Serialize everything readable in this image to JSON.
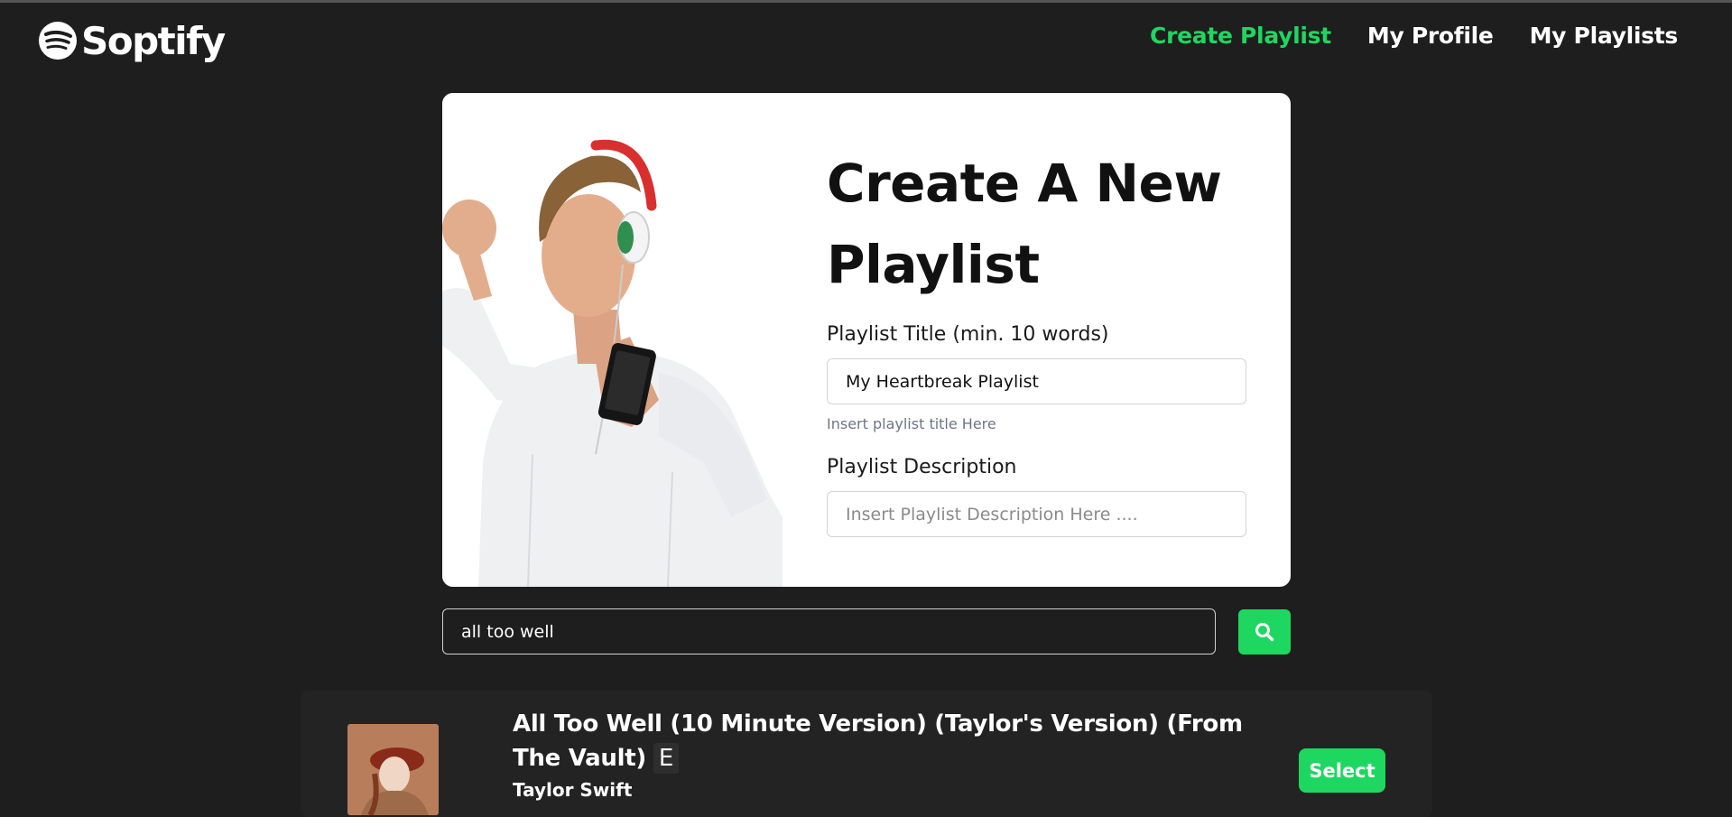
{
  "brand": {
    "name": "Soptify",
    "icon": "spotify-logo-icon"
  },
  "nav": {
    "links": [
      {
        "label": "Create Playlist",
        "active": true
      },
      {
        "label": "My Profile",
        "active": false
      },
      {
        "label": "My Playlists",
        "active": false
      }
    ]
  },
  "form": {
    "title": "Create A New Playlist",
    "title_label": "Playlist Title (min. 10 words)",
    "title_value": "My Heartbreak Playlist",
    "title_hint": "Insert playlist title Here",
    "description_label": "Playlist Description",
    "description_placeholder": "Insert Playlist Description Here ...."
  },
  "search": {
    "value": "all too well",
    "icon": "search-icon"
  },
  "results": [
    {
      "title": "All Too Well (10 Minute Version) (Taylor's Version) (From The Vault)",
      "explicit": "E",
      "artist": "Taylor Swift",
      "action": "Select"
    }
  ],
  "colors": {
    "accent": "#1ed760",
    "background": "#1e1e1e",
    "card": "#ffffff"
  }
}
